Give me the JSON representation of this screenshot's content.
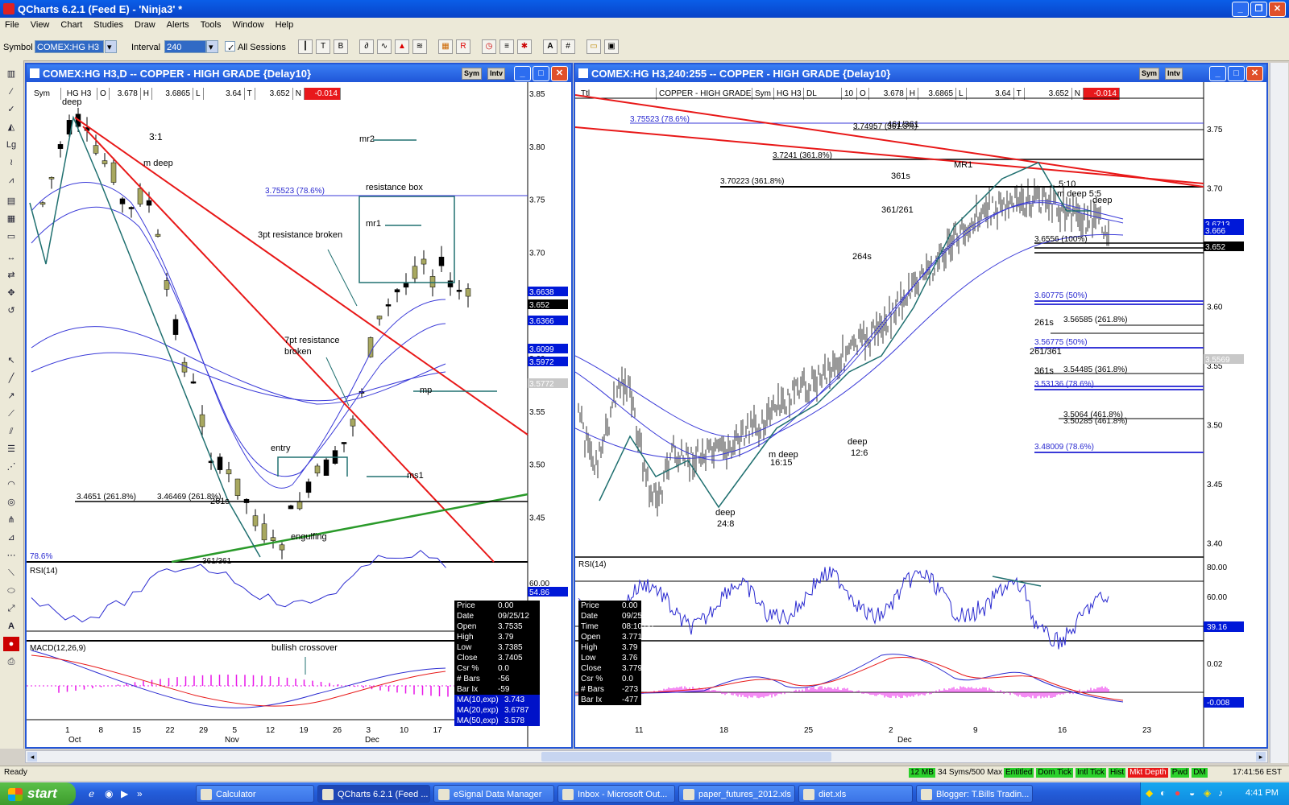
{
  "window": {
    "title": "QCharts 6.2.1 (Feed E) - 'Ninja3' *"
  },
  "menu": [
    "File",
    "View",
    "Chart",
    "Studies",
    "Draw",
    "Alerts",
    "Tools",
    "Window",
    "Help"
  ],
  "toolbar": {
    "symbol_label": "Symbol",
    "symbol_value": "COMEX:HG H3",
    "interval_label": "Interval",
    "interval_value": "240",
    "all_sessions": "All Sessions"
  },
  "left_chart": {
    "title": "COMEX:HG H3,D -- COPPER - HIGH GRADE {Delay10}",
    "sym_btn": "Sym",
    "intv_btn": "Intv",
    "quote": {
      "sym": "Sym",
      "symbol": "HG H3",
      "o_label": "O",
      "o": "3.678",
      "h_label": "H",
      "h": "3.6865",
      "l_label": "L",
      "l": "3.64",
      "t_label": "T",
      "t": "3.652",
      "n_label": "N",
      "n": "-0.014"
    },
    "annotations": {
      "deep": "deep",
      "ratio": "3:1",
      "m_deep": "m deep",
      "mr2": "mr2",
      "fib": "3.75523 (78.6%)",
      "resistance_box": "resistance box",
      "mr1": "mr1",
      "pt3": "3pt resistance broken",
      "pt7a": "7pt resistance",
      "pt7b": "broken",
      "mp": "mp",
      "entry": "entry",
      "ms1": "ms1",
      "fib2a": "3.4651 (261.8%)",
      "fib2b": "3.46469 (261.8%)",
      "s261": "261s",
      "engulfing": "engulfing",
      "p786": "78.6%",
      "s361": "361/361",
      "rsi": "RSI(14)",
      "macd": "MACD(12,26,9)",
      "bullish": "bullish crossover"
    },
    "price_axis": [
      "3.85",
      "3.80",
      "3.75",
      "3.70",
      "3.65",
      "3.60",
      "3.55",
      "3.50",
      "3.45"
    ],
    "price_tags": [
      {
        "v": "3.6638",
        "c": "#0018d8",
        "fg": "#fff"
      },
      {
        "v": "3.652",
        "c": "#000",
        "fg": "#fff"
      },
      {
        "v": "3.6366",
        "c": "#0018d8",
        "fg": "#fff"
      },
      {
        "v": "3.6099",
        "c": "#0018d8",
        "fg": "#fff"
      },
      {
        "v": "3.5972",
        "c": "#0018d8",
        "fg": "#fff"
      },
      {
        "v": "3.5772",
        "c": "#c8c8c8",
        "fg": "#fff"
      }
    ],
    "rsi_axis": [
      "60.00",
      "54.86"
    ],
    "x_axis": [
      "1",
      "8",
      "15",
      "22",
      "29",
      "5",
      "12",
      "19",
      "26",
      "3",
      "10",
      "17"
    ],
    "months": [
      "Oct",
      "Nov",
      "Dec"
    ],
    "data_box": [
      [
        "Price",
        "0.00"
      ],
      [
        "Date",
        "09/25/12"
      ],
      [
        "Open",
        "3.7535"
      ],
      [
        "High",
        "3.79"
      ],
      [
        "Low",
        "3.7385"
      ],
      [
        "Close",
        "3.7405"
      ],
      [
        "Csr %",
        "0.0"
      ],
      [
        "# Bars",
        "-56"
      ],
      [
        "Bar Ix",
        "-59"
      ]
    ],
    "ma_box": [
      [
        "MA(10,exp)",
        "3.743"
      ],
      [
        "MA(20,exp)",
        "3.6787"
      ],
      [
        "MA(50,exp)",
        "3.578"
      ]
    ]
  },
  "right_chart": {
    "title": "COMEX:HG H3,240:255 -- COPPER - HIGH GRADE {Delay10}",
    "sym_btn": "Sym",
    "intv_btn": "Intv",
    "quote": {
      "ttl": "Ttl",
      "name": "COPPER - HIGH GRADE",
      "sym": "Sym",
      "symbol": "HG H3",
      "dl": "DL",
      "ten": "10",
      "o_label": "O",
      "o": "3.678",
      "h_label": "H",
      "h": "3.6865",
      "l_label": "L",
      "l": "3.64",
      "t_label": "T",
      "t": "3.652",
      "n_label": "N",
      "n": "-0.014"
    },
    "annotations": {
      "fib786": "3.75523 (78.6%)",
      "fib361a": "3.74957 (361.8%)",
      "s461": "461/361",
      "fib7241": "3.7241 (361.8%)",
      "mr1": "MR1",
      "s361s": "361s",
      "fib70223": "3.70223 (361.8%)",
      "s510": "5:10",
      "m_deep": "m deep 5:5",
      "deep": "deep",
      "s361261": "361/261",
      "fib100": "3.6556 (100%)",
      "s264": "264s",
      "fib50": "3.60775 (50%)",
      "s261s": "261s",
      "fib56585": "3.56585 (261.8%)",
      "fib56775": "3.56775 (50%)",
      "s261361": "261/361",
      "s361b": "361s",
      "fib54485": "3.54485 (361.8%)",
      "fib786b": "3.53136 (78.6%)",
      "fib5064": "3.5064 (461.8%)",
      "fib50285": "3.50285 (461.8%)",
      "fib48009": "3.48009 (78.6%)",
      "deep126a": "deep",
      "deep126b": "12:6",
      "mdeep1615a": "m deep",
      "mdeep1615b": "16:15",
      "deep248a": "deep",
      "deep248b": "24:8",
      "rsi": "RSI(14)"
    },
    "price_axis": [
      "3.75",
      "3.70",
      "3.65",
      "3.60",
      "3.55",
      "3.50",
      "3.45",
      "3.40"
    ],
    "price_tags": [
      {
        "v": "3.6713",
        "c": "#0018d8",
        "fg": "#fff"
      },
      {
        "v": "3.666",
        "c": "#0018d8",
        "fg": "#fff"
      },
      {
        "v": "3.652",
        "c": "#000",
        "fg": "#fff"
      },
      {
        "v": "3.5569",
        "c": "#c8c8c8",
        "fg": "#fff"
      }
    ],
    "rsi_axis": [
      "80.00",
      "60.00",
      "39.16"
    ],
    "macd_axis": [
      "0.02",
      "-0.008"
    ],
    "x_axis": [
      "11",
      "18",
      "25",
      "2",
      "9",
      "16",
      "23"
    ],
    "months": [
      "Dec"
    ],
    "data_box": [
      [
        "Price",
        "0.00"
      ],
      [
        "Date",
        "09/25/12"
      ],
      [
        "Time",
        "08:10:00"
      ],
      [
        "Open",
        "3.771"
      ],
      [
        "High",
        "3.79"
      ],
      [
        "Low",
        "3.76"
      ],
      [
        "Close",
        "3.779"
      ],
      [
        "Csr %",
        "0.0"
      ],
      [
        "# Bars",
        "-273"
      ],
      [
        "Bar Ix",
        "-477"
      ]
    ]
  },
  "status": {
    "ready": "Ready",
    "mem": "12 MB",
    "syms": "34 Syms/500 Max",
    "badges": [
      {
        "t": "Entitled",
        "c": "#2bd12b"
      },
      {
        "t": "Dom Tick",
        "c": "#2bd12b"
      },
      {
        "t": "Intl Tick",
        "c": "#2bd12b"
      },
      {
        "t": "Hist",
        "c": "#2bd12b"
      },
      {
        "t": "Mkt Depth",
        "c": "#e81818"
      },
      {
        "t": "Pwd",
        "c": "#2bd12b"
      },
      {
        "t": "DM",
        "c": "#2bd12b"
      }
    ],
    "time": "17:41:56 EST"
  },
  "taskbar": {
    "start": "start",
    "tasks": [
      "Calculator",
      "QCharts 6.2.1 (Feed ...",
      "eSignal Data Manager",
      "Inbox - Microsoft Out...",
      "paper_futures_2012.xls",
      "diet.xls",
      "Blogger: T.Bills Tradin..."
    ],
    "clock": "4:41 PM"
  }
}
